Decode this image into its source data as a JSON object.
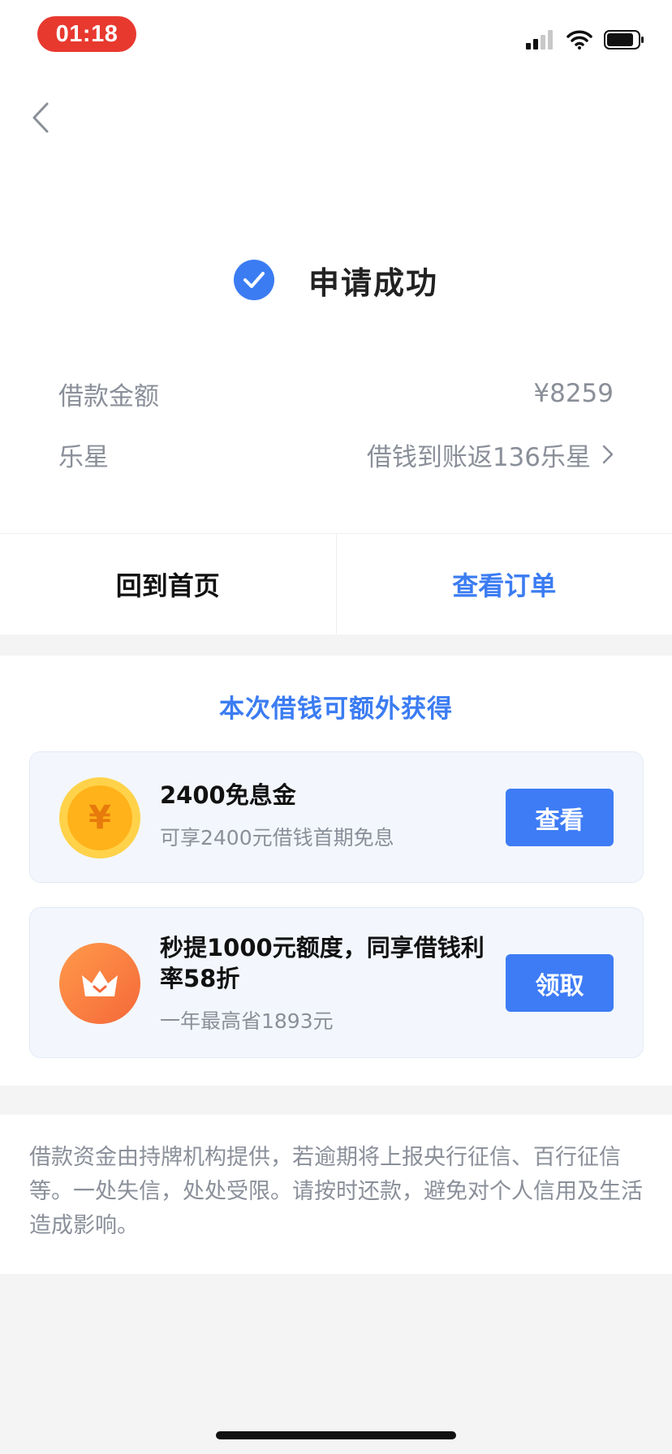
{
  "status_bar": {
    "time": "01:18",
    "colors": {
      "time_pill": "#e8392f"
    },
    "icons": [
      "signal-icon",
      "wifi-icon",
      "battery-icon"
    ]
  },
  "header": {
    "back_icon": "chevron-left-icon"
  },
  "result": {
    "title": "申请成功",
    "icon": "check-circle-icon",
    "accent": "#3b7cf2"
  },
  "details": {
    "amount_label": "借款金额",
    "amount_value": "¥8259",
    "star_label": "乐星",
    "star_value": "借钱到账返136乐星"
  },
  "actions": {
    "home_label": "回到首页",
    "orders_label": "查看订单"
  },
  "rewards": {
    "title": "本次借钱可额外获得",
    "items": [
      {
        "title": "2400免息金",
        "subtitle": "可享2400元借钱首期免息",
        "button": "查看",
        "icon": "coin-yuan-icon"
      },
      {
        "title": "秒提1000元额度，同享借钱利率58折",
        "subtitle": "一年最高省1893元",
        "button": "领取",
        "icon": "crown-icon"
      }
    ]
  },
  "disclaimer": "借款资金由持牌机构提供，若逾期将上报央行征信、百行征信等。一处失信，处处受限。请按时还款，避免对个人信用及生活造成影响。"
}
